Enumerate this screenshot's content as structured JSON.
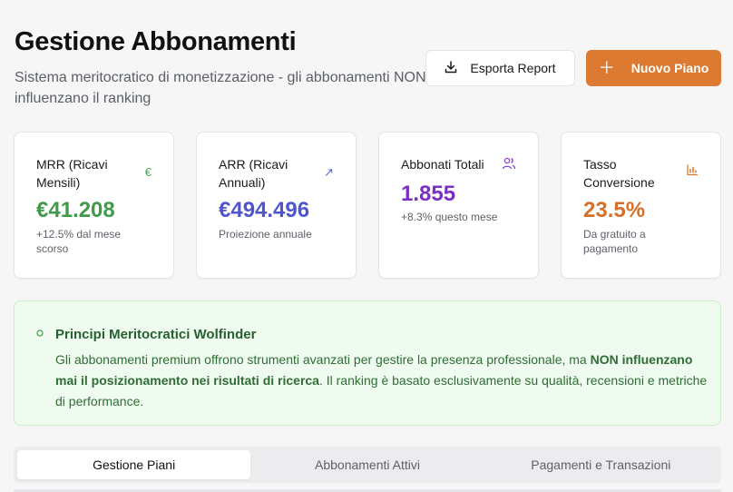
{
  "header": {
    "title": "Gestione Abbonamenti",
    "subtitle": "Sistema meritocratico di monetizzazione - gli abbonamenti NON influenzano il ranking"
  },
  "actions": {
    "export_label": "Esporta Report",
    "export_icon": "download-icon",
    "new_plan_label": "Nuovo Piano",
    "new_plan_icon": "plus-icon"
  },
  "stats": [
    {
      "label": "MRR (Ricavi Mensili)",
      "icon": "euro-icon",
      "icon_glyph": "€",
      "icon_color": "#3fae55",
      "value": "€41.208",
      "value_color": "#3f9a4a",
      "sub": "+12.5% dal mese scorso"
    },
    {
      "label": "ARR (Ricavi Annuali)",
      "icon": "trending-up-icon",
      "icon_glyph": "↗",
      "icon_color": "#5a63d6",
      "value": "€494.496",
      "value_color": "#4f55cc",
      "sub": "Proiezione annuale"
    },
    {
      "label": "Abbonati Totali",
      "icon": "users-icon",
      "icon_glyph": "",
      "icon_color": "#8a3fd0",
      "value": "1.855",
      "value_color": "#7b2fc4",
      "sub": "+8.3% questo mese"
    },
    {
      "label": "Tasso Conversione",
      "icon": "bar-chart-icon",
      "icon_glyph": "",
      "icon_color": "#dd7a31",
      "value": "23.5%",
      "value_color": "#d4702a",
      "sub": "Da gratuito a pagamento"
    }
  ],
  "banner": {
    "icon": "circle-icon",
    "title": "Principi Meritocratici Wolfinder",
    "text_1": "Gli abbonamenti premium offrono strumenti avanzati per gestire la presenza professionale, ma ",
    "text_bold": "NON influenzano mai il posizionamento nei risultati di ricerca",
    "text_2": ". Il ranking è basato esclusivamente su qualità, recensioni e metriche di performance."
  },
  "tabs": [
    {
      "label": "Gestione Piani",
      "active": true
    },
    {
      "label": "Abbonamenti Attivi",
      "active": false
    },
    {
      "label": "Pagamenti e Transazioni",
      "active": false
    }
  ],
  "colors": {
    "accent": "#dd7a31",
    "banner_bg": "#effbef",
    "banner_text": "#2f6d35"
  }
}
